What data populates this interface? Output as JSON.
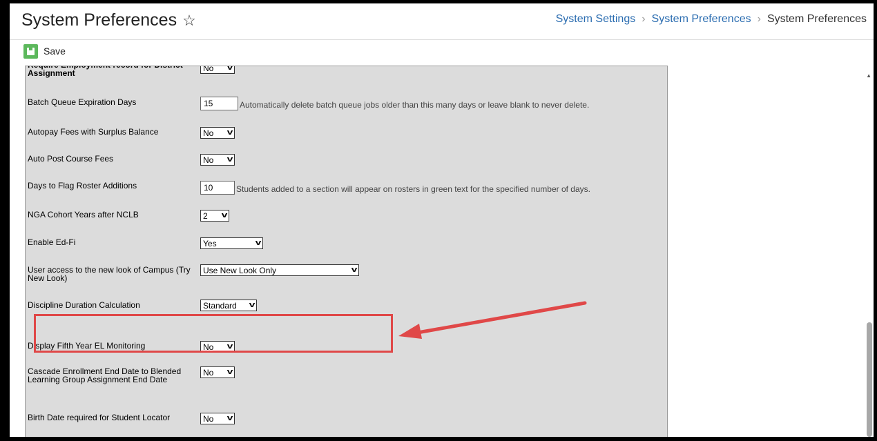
{
  "header": {
    "title": "System Preferences",
    "star": "☆",
    "breadcrumb": [
      "System Settings",
      "System Preferences",
      "System Preferences"
    ],
    "separator": "›"
  },
  "toolbar": {
    "save_label": "Save"
  },
  "rows": [
    {
      "label": "Require Employment record for District Assignment",
      "value": "No"
    },
    {
      "label": "Batch Queue Expiration Days",
      "value": "15",
      "help": "Automatically delete batch queue jobs older than this many days or leave blank to never delete."
    },
    {
      "label": "Autopay Fees with Surplus Balance",
      "value": "No"
    },
    {
      "label": "Auto Post Course Fees",
      "value": "No"
    },
    {
      "label": "Days to Flag Roster Additions",
      "value": "10",
      "help": "Students added to a section will appear on rosters in green text for the specified number of days."
    },
    {
      "label": "NGA Cohort Years after NCLB",
      "value": "2"
    },
    {
      "label": "Enable Ed-Fi",
      "value": "Yes"
    },
    {
      "label": "User access to the new look of Campus (Try New Look)",
      "value": "Use New Look Only"
    },
    {
      "label": "Discipline Duration Calculation",
      "value": "Standard"
    },
    {
      "label": "Display Fifth Year EL Monitoring",
      "value": "No"
    },
    {
      "label": "Cascade Enrollment End Date to Blended Learning Group Assignment End Date",
      "value": "No"
    },
    {
      "label": "Birth Date required for Student Locator",
      "value": "No"
    }
  ],
  "annotation": {
    "highlight_color": "#e04848"
  },
  "colors": {
    "accent": "#5cb85c",
    "link": "#2a6cb0",
    "panel": "#dcdcdc"
  }
}
